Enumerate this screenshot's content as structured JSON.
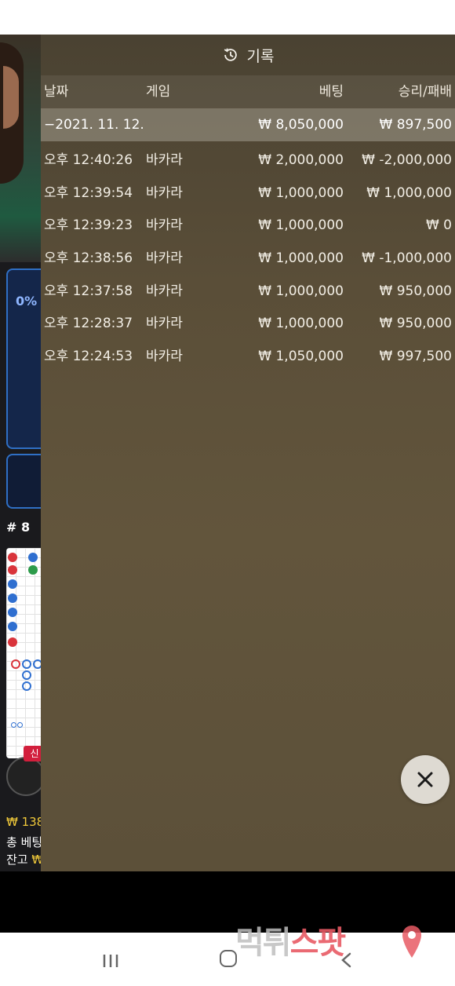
{
  "panel": {
    "title": "기록",
    "columns": {
      "date": "날짜",
      "game": "게임",
      "bet": "베팅",
      "result": "승리/패배"
    },
    "summary": {
      "date": "−2021. 11. 12.",
      "bet": "₩ 8,050,000",
      "result": "₩ 897,500"
    },
    "rows": [
      {
        "time": "오후 12:40:26",
        "game": "바카라",
        "bet": "₩ 2,000,000",
        "result": "₩ -2,000,000"
      },
      {
        "time": "오후 12:39:54",
        "game": "바카라",
        "bet": "₩ 1,000,000",
        "result": "₩ 1,000,000"
      },
      {
        "time": "오후 12:39:23",
        "game": "바카라",
        "bet": "₩ 1,000,000",
        "result": "₩ 0"
      },
      {
        "time": "오후 12:38:56",
        "game": "바카라",
        "bet": "₩ 1,000,000",
        "result": "₩ -1,000,000"
      },
      {
        "time": "오후 12:37:58",
        "game": "바카라",
        "bet": "₩ 1,000,000",
        "result": "₩ 950,000"
      },
      {
        "time": "오후 12:28:37",
        "game": "바카라",
        "bet": "₩ 1,000,000",
        "result": "₩ 950,000"
      },
      {
        "time": "오후 12:24:53",
        "game": "바카라",
        "bet": "₩ 1,050,000",
        "result": "₩ 997,500"
      }
    ],
    "close_icon": "close-icon",
    "history_icon": "history-clock-icon"
  },
  "background_game": {
    "bet_percent": "0%",
    "shoe_label": "# 8",
    "tag_text": "신",
    "balance_amount": "₩ 138",
    "total_bet_label": "총 베팅",
    "remaining_label": "잔고",
    "remaining_amount": "₩"
  },
  "nav": {
    "recent_icon": "recent-apps-icon",
    "home_icon": "home-icon",
    "back_icon": "back-icon"
  },
  "watermark": {
    "part1": "먹튀",
    "part2": "스팟"
  },
  "colors": {
    "panel_bg": "#5a4e38",
    "summary_bg": "#a49d8e",
    "accent_gold": "#f0c93a",
    "blue_border": "#2f6fc4"
  }
}
